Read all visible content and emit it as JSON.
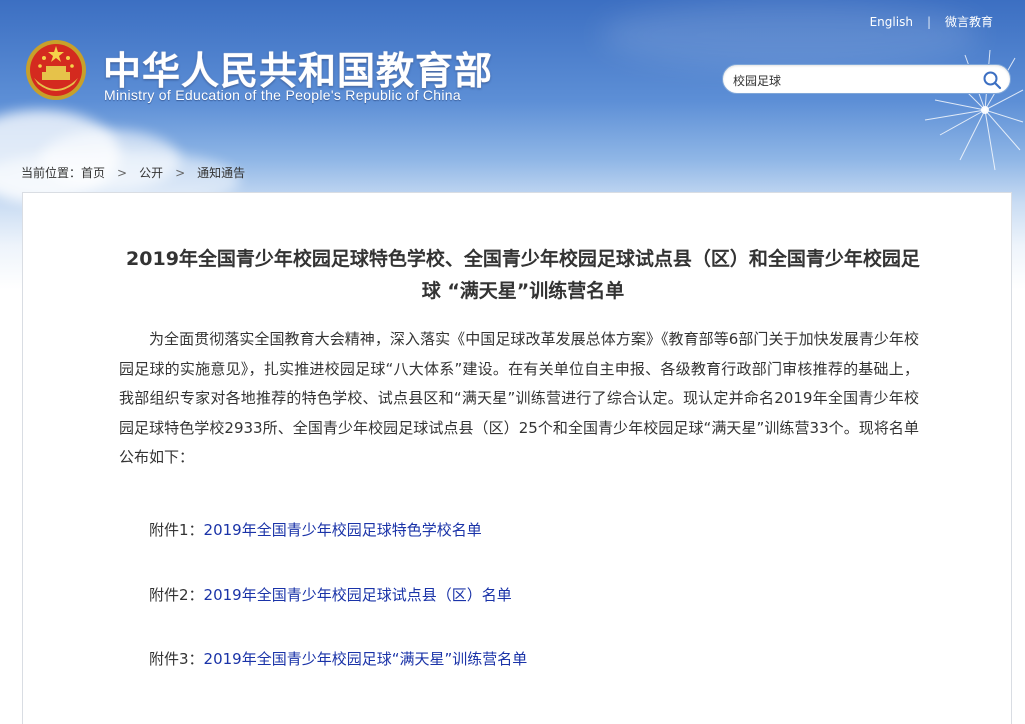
{
  "header": {
    "cn_title": "中华人民共和国教育部",
    "en_title": "Ministry of Education of the People's Republic of China",
    "links": {
      "english": "English",
      "weibo": "微言教育"
    },
    "search": {
      "value": "校园足球"
    }
  },
  "breadcrumb": {
    "prefix": "当前位置：",
    "items": [
      "首页",
      "公开",
      "通知通告"
    ],
    "separator": ">"
  },
  "article": {
    "title": "2019年全国青少年校园足球特色学校、全国青少年校园足球试点县（区）和全国青少年校园足球 “满天星”训练营名单",
    "body": "为全面贯彻落实全国教育大会精神，深入落实《中国足球改革发展总体方案》《教育部等6部门关于加快发展青少年校园足球的实施意见》，扎实推进校园足球“八大体系”建设。在有关单位自主申报、各级教育行政部门审核推荐的基础上，我部组织专家对各地推荐的特色学校、试点县区和“满天星”训练营进行了综合认定。现认定并命名2019年全国青少年校园足球特色学校2933所、全国青少年校园足球试点县（区）25个和全国青少年校园足球“满天星”训练营33个。现将名单公布如下：",
    "attachments": [
      {
        "prefix": "附件1：",
        "label": "2019年全国青少年校园足球特色学校名单"
      },
      {
        "prefix": "附件2：",
        "label": "2019年全国青少年校园足球试点县（区）名单"
      },
      {
        "prefix": "附件3：",
        "label": "2019年全国青少年校园足球“满天星”训练营名单"
      }
    ]
  },
  "colors": {
    "link": "#1a33a8",
    "sky": "#3c6fc2",
    "text": "#333333"
  }
}
